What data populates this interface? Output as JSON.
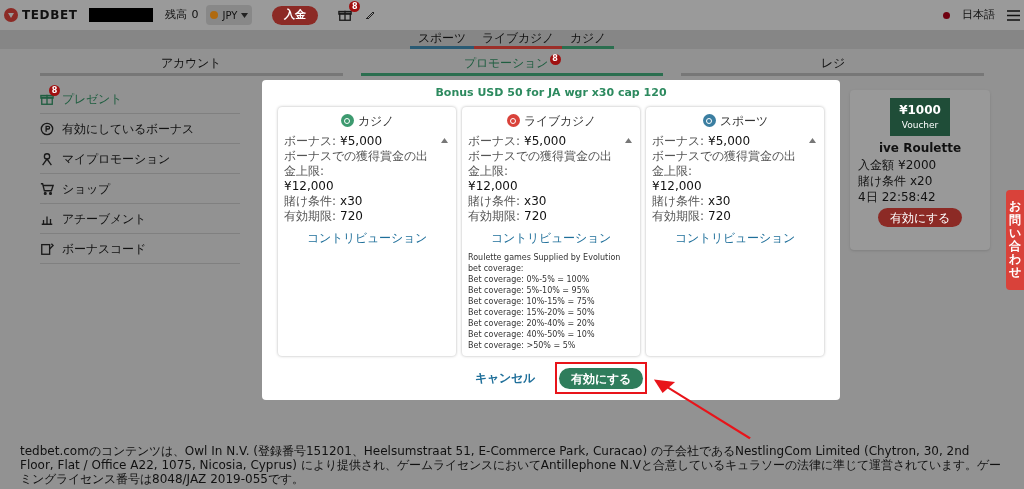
{
  "header": {
    "logo": "TEDBET",
    "balance_label": "残高",
    "balance_value": "0",
    "currency": "JPY",
    "deposit": "入金",
    "gift_badge": "8",
    "language": "日本語"
  },
  "subnav": [
    {
      "label": "スポーツ",
      "color": "#2a5a73"
    },
    {
      "label": "ライブカジノ",
      "color": "#9c2f29"
    },
    {
      "label": "カジノ",
      "color": "#2b6e4f"
    }
  ],
  "tabs": [
    {
      "label": "アカウント",
      "selected": false
    },
    {
      "label": "プロモーション",
      "selected": true,
      "badge": "8"
    },
    {
      "label": "レジ",
      "selected": false
    }
  ],
  "sidebar": [
    {
      "label": "プレゼント",
      "selected": true,
      "badge": "8"
    },
    {
      "label": "有効にしているボーナス",
      "selected": false
    },
    {
      "label": "マイプロモーション",
      "selected": false
    },
    {
      "label": "ショップ",
      "selected": false
    },
    {
      "label": "アチーブメント",
      "selected": false
    },
    {
      "label": "ボーナスコード",
      "selected": false
    }
  ],
  "promo_card": {
    "amount": "¥1000",
    "tag": "Voucher",
    "title": "ive Roulette",
    "rows": [
      {
        "label": "入金額",
        "value": "¥2000"
      },
      {
        "label": "賭け条件",
        "value": "x20"
      },
      {
        "label": "4日",
        "value": "22:58:42"
      }
    ],
    "button": "有効にする"
  },
  "modal": {
    "title": "Bonus USD 50 for JA wgr x30 cap 120",
    "sections": [
      {
        "name": "カジノ",
        "color": "#3d9a6f",
        "rows": [
          {
            "label": "ボーナス:",
            "value": "¥5,000"
          },
          {
            "label": "ボーナスでの獲得賞金の出金上限:",
            "value": "¥12,000"
          },
          {
            "label": "賭け条件:",
            "value": "x30"
          },
          {
            "label": "有効期限:",
            "value": "720"
          }
        ],
        "link": "コントリビューション"
      },
      {
        "name": "ライブカジノ",
        "color": "#d9423a",
        "rows": [
          {
            "label": "ボーナス:",
            "value": "¥5,000"
          },
          {
            "label": "ボーナスでの獲得賞金の出金上限:",
            "value": "¥12,000"
          },
          {
            "label": "賭け条件:",
            "value": "x30"
          },
          {
            "label": "有効期限:",
            "value": "720"
          }
        ],
        "link": "コントリビューション",
        "notes": [
          "Roulette games Supplied by Evolution bet coverage:",
          "Bet coverage: 0%-5% = 100%",
          "Bet coverage: 5%-10% = 95%",
          "Bet coverage: 10%-15% = 75%",
          "Bet coverage: 15%-20% = 50%",
          "Bet coverage: 20%-40% = 20%",
          "Bet coverage: 40%-50% = 10%",
          "Bet coverage: >50% = 5%"
        ]
      },
      {
        "name": "スポーツ",
        "color": "#3b7ea1",
        "rows": [
          {
            "label": "ボーナス:",
            "value": "¥5,000"
          },
          {
            "label": "ボーナスでの獲得賞金の出金上限:",
            "value": "¥12,000"
          },
          {
            "label": "賭け条件:",
            "value": "x30"
          },
          {
            "label": "有効期限:",
            "value": "720"
          }
        ],
        "link": "コントリビューション"
      }
    ],
    "cancel": "キャンセル",
    "confirm": "有効にする"
  },
  "contact_tab": "お問い合わせ",
  "footer": "tedbet.comのコンテンツは、Owl In N.V. (登録番号151201、Heelsumstraat 51, E-Commerce Park, Curacao) の子会社であるNestlingCom Limited (Chytron, 30, 2nd Floor, Flat / Office A22, 1075, Nicosia, Cyprus) により提供され、ゲームライセンスにおいてAntillephone N.Vと合意しているキュラソーの法律に準じて運営されています。ゲーミングライセンス番号は8048/JAZ 2019-055です。"
}
